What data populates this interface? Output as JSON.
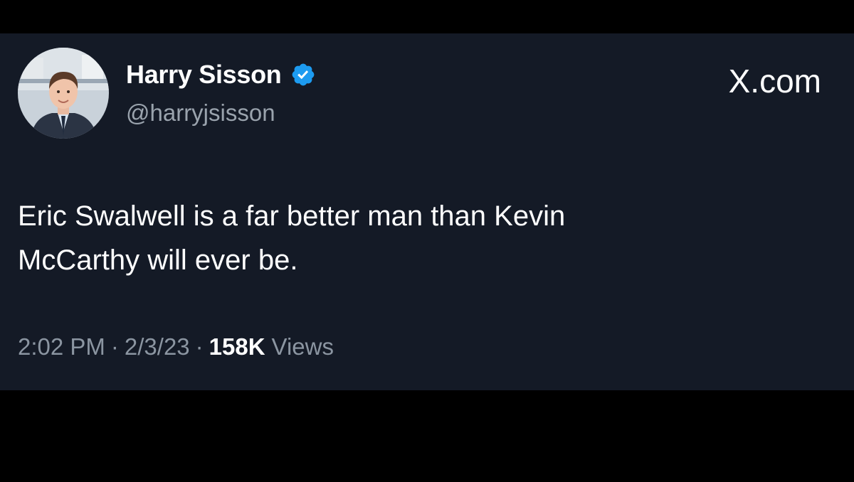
{
  "tweet": {
    "author": {
      "display_name": "Harry Sisson",
      "handle": "@harryjsisson",
      "verified": true,
      "verified_icon": "verified-badge-icon"
    },
    "site_label": "X.com",
    "text_lines": [
      "Eric Swalwell is a far better man than Kevin",
      "McCarthy will ever be."
    ],
    "meta": {
      "time": "2:02 PM",
      "separator": "·",
      "date": "2/3/23",
      "views_count": "158K",
      "views_label": "Views"
    }
  },
  "colors": {
    "background": "#000000",
    "card": "#141a26",
    "verified": "#1d9bf0",
    "secondary_text": "#8b95a1"
  }
}
